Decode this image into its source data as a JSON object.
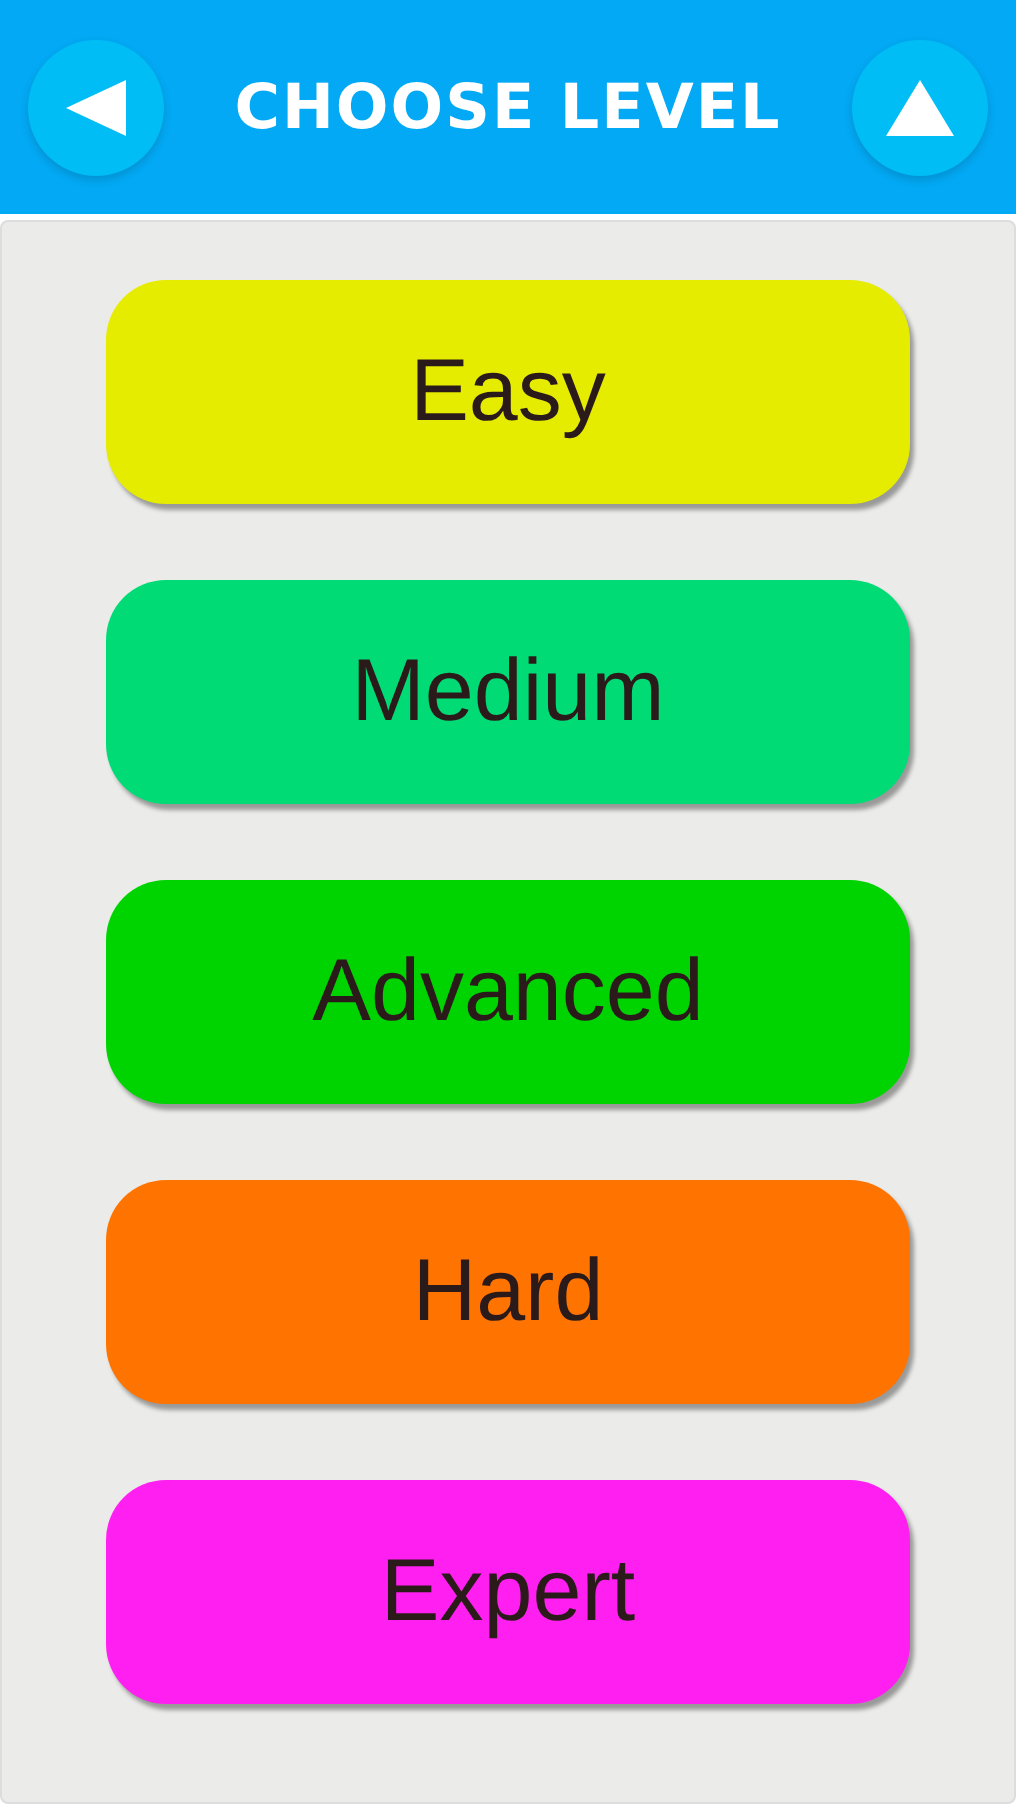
{
  "header": {
    "title": "CHOOSE LEVEL"
  },
  "levels": [
    {
      "label": "Easy",
      "color": "#e5ec00"
    },
    {
      "label": "Medium",
      "color": "#00db76"
    },
    {
      "label": "Advanced",
      "color": "#00d400"
    },
    {
      "label": "Hard",
      "color": "#ff7300"
    },
    {
      "label": "Expert",
      "color": "#ff1ff0"
    }
  ]
}
